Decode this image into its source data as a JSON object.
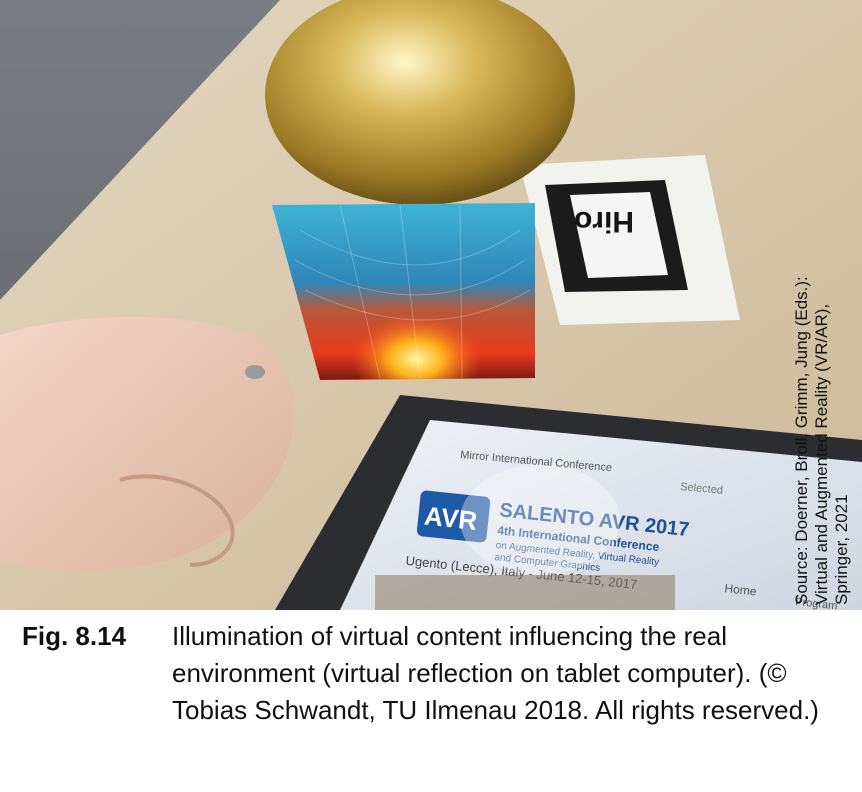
{
  "figure": {
    "label": "Fig. 8.14",
    "caption": "Illumination of virtual content influencing the real environment (virtual reflection on tablet computer). (© Tobias Schwandt, TU Ilmenau 2018. All rights reserved.)"
  },
  "source_note": "Source: Doerner, Broll, Grimm, Jung (Eds.):\nVirtual and Augmented Reality (VR/AR),\nSpringer, 2021",
  "photo": {
    "marker_text": "Hiro",
    "tablet": {
      "header": "Mirror International Conference",
      "search": "Selected",
      "logo": "AVR",
      "title": "SALENTO AVR 2017",
      "subtitle_1": "4th International Conference",
      "subtitle_2": "on Augmented Reality, Virtual Reality",
      "subtitle_3": "and Computer Graphics",
      "location": "Ugento (Lecce), Italy - June 12-15, 2017",
      "nav_home": "Home",
      "nav_program": "Program"
    }
  },
  "colors": {
    "table": "#d9c9b0",
    "carpet": "#6b6e73",
    "sphere": "#c9a646",
    "tablet_frame": "#2b2d31"
  }
}
